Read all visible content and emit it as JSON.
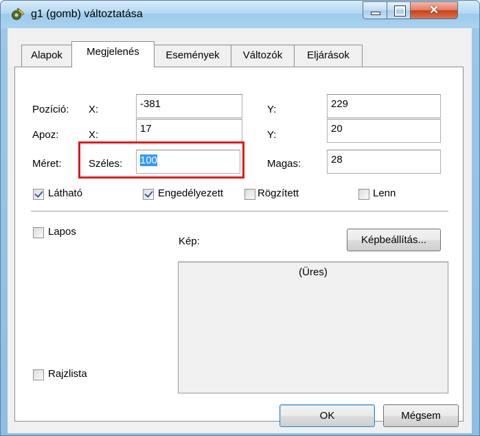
{
  "window": {
    "title": "g1 (gomb) változtatása",
    "icon": "gear-pencil-icon",
    "controls": {
      "minimize": "minimize-icon",
      "maximize": "maximize-icon",
      "close": "close-icon"
    }
  },
  "tabs": [
    {
      "label": "Alapok",
      "active": false
    },
    {
      "label": "Megjelenés",
      "active": true
    },
    {
      "label": "Események",
      "active": false
    },
    {
      "label": "Változók",
      "active": false
    },
    {
      "label": "Eljárások",
      "active": false
    }
  ],
  "form": {
    "pozicio": {
      "label": "Pozíció:",
      "x_label": "X:",
      "x_value": "-381",
      "y_label": "Y:",
      "y_value": "229"
    },
    "apoz": {
      "label": "Apoz:",
      "x_label": "X:",
      "x_value": "17",
      "y_label": "Y:",
      "y_value": "20"
    },
    "meret": {
      "label": "Méret:",
      "width_label": "Széles:",
      "width_value": "100",
      "height_label": "Magas:",
      "height_value": "28"
    }
  },
  "checkboxes": {
    "lathato": {
      "label": "Látható",
      "checked": true
    },
    "engedelyezett": {
      "label": "Engedélyezett",
      "checked": true
    },
    "rogzitett": {
      "label": "Rögzített",
      "checked": false
    },
    "lenn": {
      "label": "Lenn",
      "checked": false
    },
    "lapos": {
      "label": "Lapos",
      "checked": false
    },
    "rajzlista": {
      "label": "Rajzlista",
      "checked": false
    }
  },
  "image": {
    "label": "Kép:",
    "settings_button": "Képbeállítás...",
    "preview_text": "(Üres)"
  },
  "buttons": {
    "ok": "OK",
    "cancel": "Mégsem"
  },
  "colors": {
    "highlight": "#e5141b",
    "selection": "#3399ff"
  }
}
